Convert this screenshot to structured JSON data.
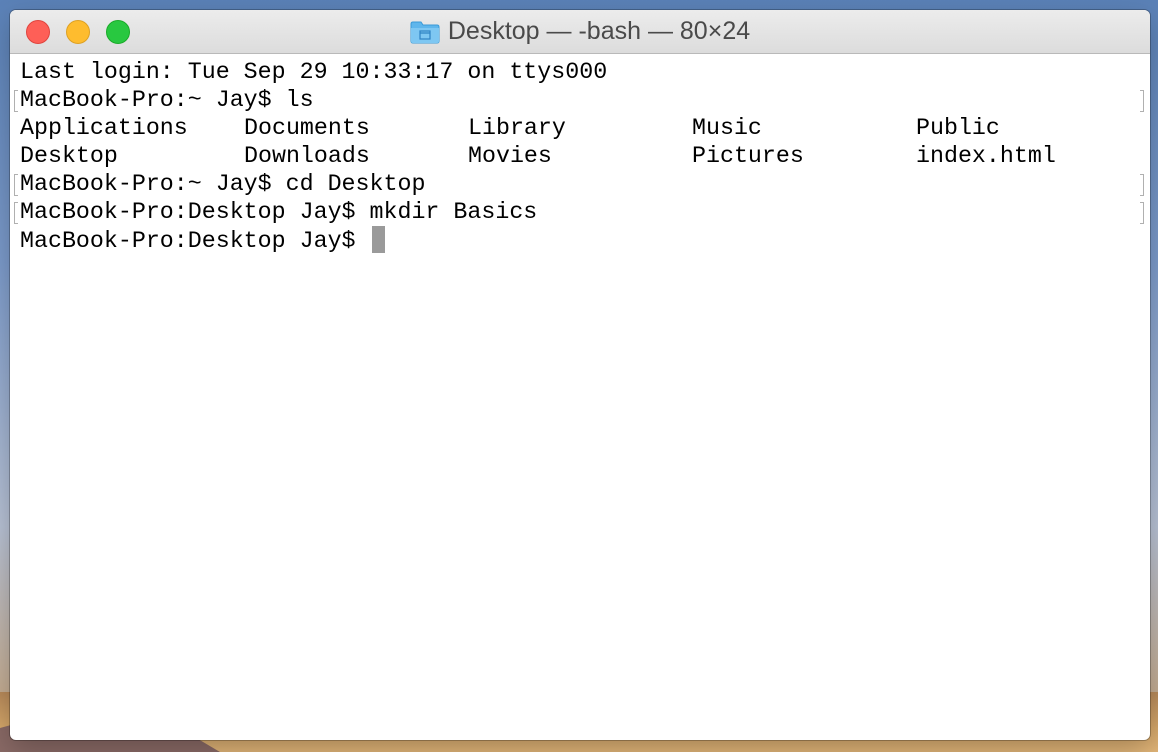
{
  "window": {
    "title": "Desktop — -bash — 80×24",
    "title_icon": "folder-icon"
  },
  "terminal": {
    "last_login": "Last login: Tue Sep 29 10:33:17 on ttys000",
    "cmd1": "MacBook-Pro:~ Jay$ ls",
    "ls_row1": [
      "Applications",
      "Documents",
      "Library",
      "Music",
      "Public"
    ],
    "ls_row2": [
      "Desktop",
      "Downloads",
      "Movies",
      "Pictures",
      "index.html"
    ],
    "cmd2": "MacBook-Pro:~ Jay$ cd Desktop",
    "cmd3": "MacBook-Pro:Desktop Jay$ mkdir Basics",
    "prompt": "MacBook-Pro:Desktop Jay$ "
  },
  "colors": {
    "close": "#fe5f57",
    "minimize": "#febc2e",
    "zoom": "#28c840",
    "cursor": "#9a9a9a"
  }
}
